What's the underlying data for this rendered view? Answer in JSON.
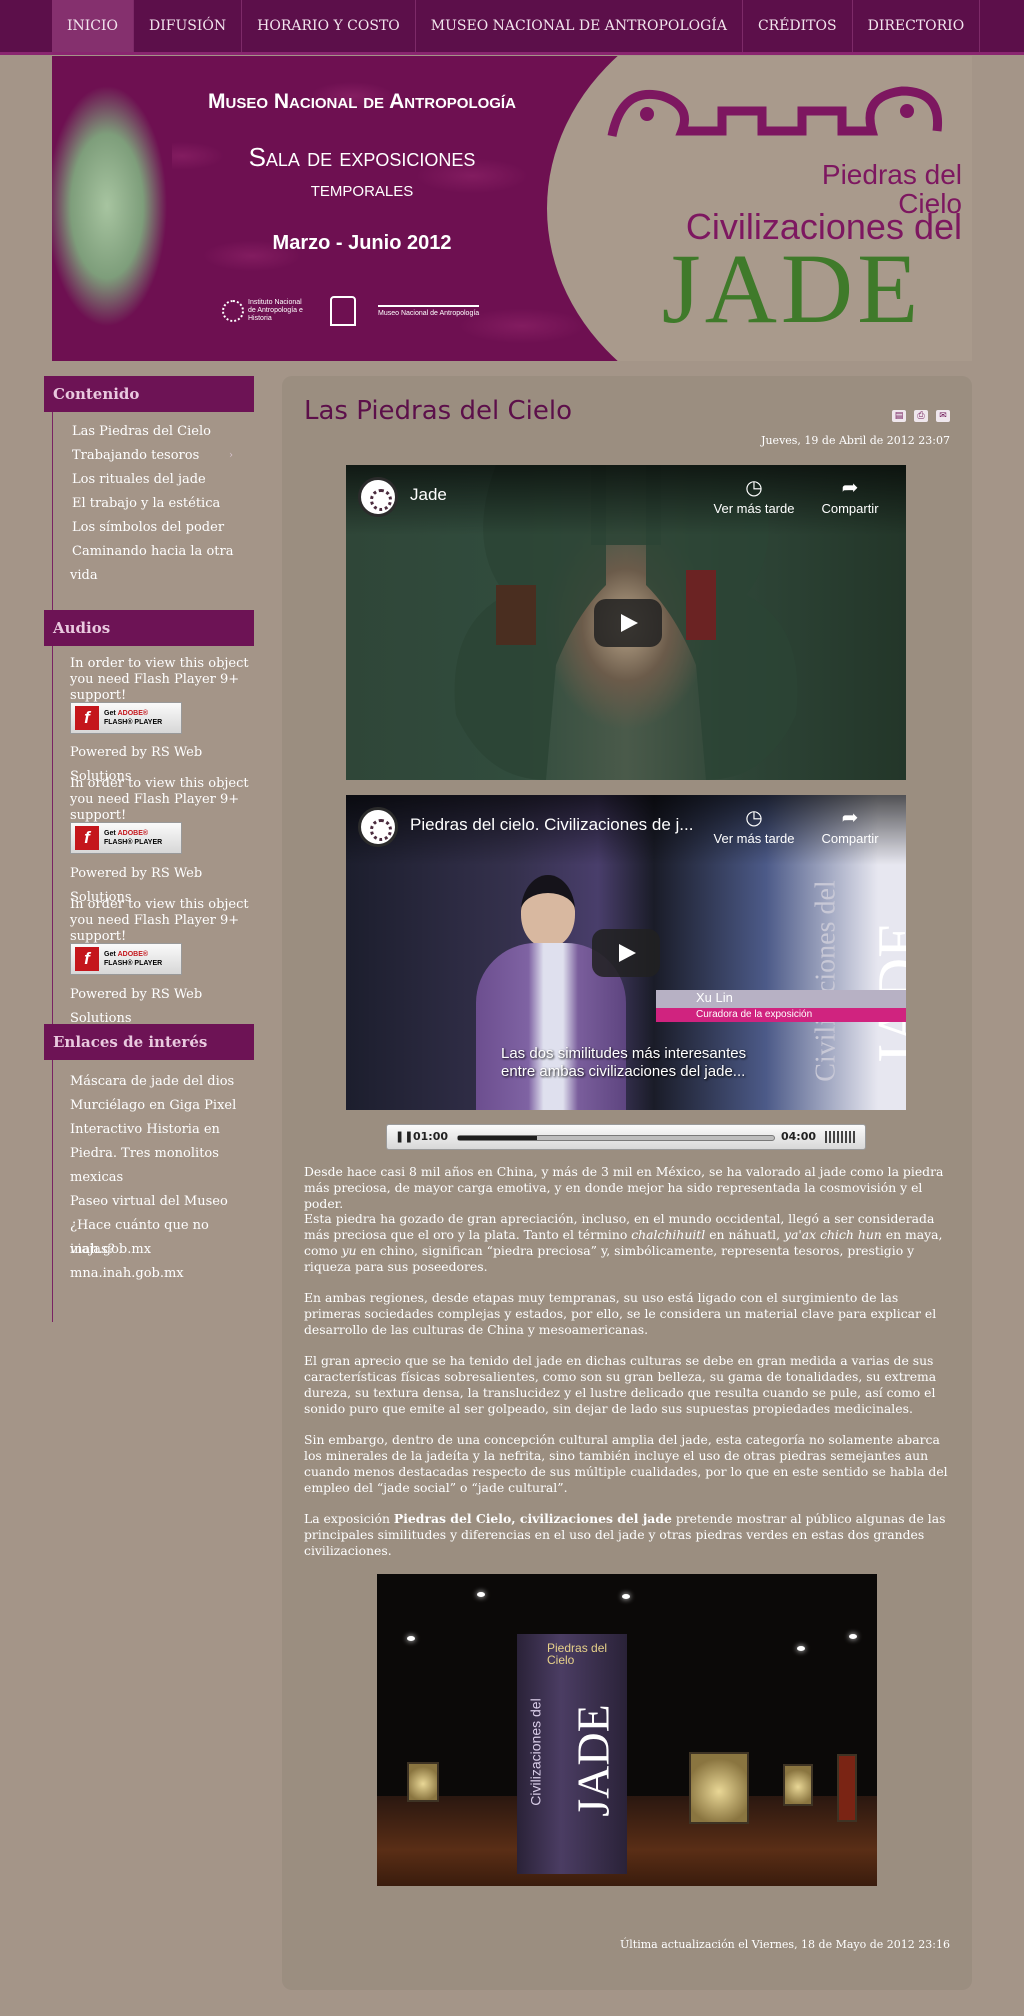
{
  "nav": {
    "items": [
      {
        "label": "INICIO",
        "active": true
      },
      {
        "label": "DIFUSIÓN"
      },
      {
        "label": "HORARIO Y COSTO"
      },
      {
        "label": "MUSEO NACIONAL DE ANTROPOLOGÍA"
      },
      {
        "label": "CRÉDITOS"
      },
      {
        "label": "DIRECTORIO"
      }
    ]
  },
  "banner": {
    "museum": "Museo Nacional de Antropología",
    "hall_line1": "Sala de exposiciones",
    "hall_line2": "temporales",
    "dates": "Marzo - Junio 2012",
    "logo_inah": "Instituto Nacional de Antropología e Historia",
    "logo_mna": "Museo Nacional de Antropología",
    "expo_title_1": "Piedras del",
    "expo_title_2": "Cielo",
    "expo_title_3": "Civilizaciones del",
    "expo_title_4": "JADE"
  },
  "sidebar": {
    "contenido_heading": "Contenido",
    "contenido_items": [
      "Las Piedras del Cielo",
      "Trabajando tesoros",
      "Los rituales del jade",
      "El trabajo y la estética",
      "Los símbolos del poder",
      "Caminando hacia la otra",
      "vida"
    ],
    "audios_heading": "Audios",
    "flash_notice": "In order to view this object you need Flash Player 9+ support!",
    "flash_badge_get": "Get",
    "flash_badge_adobe": "ADOBE®",
    "flash_badge_player": "FLASH® PLAYER",
    "powered_by": "Powered by RS Web Solutions",
    "enlaces_heading": "Enlaces de interés",
    "enlaces_items": [
      "Máscara de jade del dios",
      "Murciélago en Giga Pixel",
      "Interactivo Historia en",
      "Piedra. Tres monolitos",
      "mexicas",
      "Paseo virtual del Museo",
      "¿Hace cuánto que no viajas?",
      "inah.gob.mx",
      "mna.inah.gob.mx"
    ]
  },
  "article": {
    "title": "Las Piedras del Cielo",
    "date": "Jueves, 19 de Abril de 2012 23:07",
    "video1": {
      "title": "Jade",
      "watch_later": "Ver más tarde",
      "share": "Compartir"
    },
    "video2": {
      "title": "Piedras del cielo. Civilizaciones de j...",
      "watch_later": "Ver más tarde",
      "share": "Compartir",
      "name": "Xu Lin",
      "role": "Curadora de la exposición",
      "caption_1": "Las dos similitudes más interesantes",
      "caption_2": "entre ambas civilizaciones del jade...",
      "banner_small": "Civilizaciones del",
      "banner_big": "JADE"
    },
    "audio": {
      "current": "01:00",
      "total": "04:00",
      "progress": 0.25
    },
    "p1": "Desde hace casi 8 mil años en China, y más de 3 mil en México, se ha valorado al jade como la piedra más preciosa, de mayor carga emotiva, y en donde mejor ha sido representada la cosmovisión y el poder.",
    "p2_a": "Esta piedra ha gozado de gran apreciación, incluso,  en el mundo occidental, llegó a ser considerada más preciosa que el oro y la plata. Tanto el término ",
    "p2_chal": "chalchihuitl",
    "p2_b": " en náhuatl, ",
    "p2_yaax": "ya'ax chich hun",
    "p2_c": " en maya, como ",
    "p2_yu": "yu",
    "p2_d": " en chino, significan “piedra preciosa” y, simbólicamente, representa tesoros, prestigio y riqueza para sus poseedores.",
    "p3": "En ambas regiones, desde etapas muy tempranas, su uso está ligado con el surgimiento de las primeras sociedades complejas y estados, por ello, se le considera un material clave para explicar el desarrollo de las culturas de China y mesoamericanas.",
    "p4": "El gran aprecio que se ha tenido del jade en dichas culturas se debe en gran medida a varias de sus características físicas sobresalientes, como son su gran belleza, su gama de tonalidades, su extrema dureza, su textura densa, la translucidez y el lustre delicado que resulta cuando se pule, así como el sonido puro que emite al ser golpeado, sin dejar de lado sus supuestas propiedades medicinales.",
    "p5": "Sin embargo, dentro de una concepción cultural amplia del jade, esta categoría no solamente abarca los minerales de la jadeíta y la nefrita, sino también incluye el uso de otras piedras semejantes aun cuando menos destacadas respecto de sus múltiple cualidades, por lo que en este sentido se habla del empleo del “jade social” o “jade cultural”.",
    "p6_a": "La exposición ",
    "p6_bold": "Piedras del Cielo, civilizaciones del jade",
    "p6_b": " pretende mostrar al público algunas de las principales similitudes y diferencias en el uso del jade y otras piedras verdes en estas dos grandes civilizaciones.",
    "photo": {
      "t1": "Piedras del",
      "t2": "Cielo",
      "t3": "Civilizaciones del",
      "t4": "JADE"
    },
    "updated": "Última actualización el Viernes, 18 de Mayo de 2012 23:16"
  }
}
